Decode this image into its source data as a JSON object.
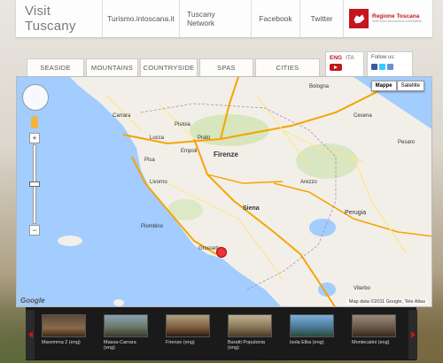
{
  "header": {
    "title": "Visit Tuscany",
    "links": [
      "Turismo.intoscana.it",
      "Tuscany Network",
      "Facebook",
      "Twitter"
    ],
    "region_name": "Regione Toscana",
    "region_subtitle": "diritti valori innovazione sostenibilità"
  },
  "nav": {
    "tabs": [
      "SEASIDE",
      "MOUNTAINS",
      "COUNTRYSIDE",
      "SPAS",
      "CITIES"
    ]
  },
  "lang": {
    "eng": "ENG",
    "ita": "ITA"
  },
  "follow": {
    "label": "Follow us:"
  },
  "map": {
    "type_buttons": [
      "Mappe",
      "Satellite"
    ],
    "active_type": "Mappe",
    "attribution": "Map data ©2011 Google, Tele Atlas",
    "logo": "Google",
    "places": [
      {
        "name": "Lucca"
      },
      {
        "name": "Pistoia"
      },
      {
        "name": "Prato"
      },
      {
        "name": "Firenze"
      },
      {
        "name": "Pisa"
      },
      {
        "name": "Livorno"
      },
      {
        "name": "Siena"
      },
      {
        "name": "Arezzo"
      },
      {
        "name": "Perugia"
      },
      {
        "name": "Grosseto"
      },
      {
        "name": "Viterbo"
      },
      {
        "name": "Carrara"
      },
      {
        "name": "Bologna"
      },
      {
        "name": "Cesena"
      },
      {
        "name": "Pesaro"
      },
      {
        "name": "Piombino"
      },
      {
        "name": "Empoli"
      }
    ]
  },
  "thumbnails": [
    {
      "caption": "Maremma 2 (eng)"
    },
    {
      "caption": "Massa-Carrara (eng)"
    },
    {
      "caption": "Firenze (eng)"
    },
    {
      "caption": "Baratti Populonia (eng)"
    },
    {
      "caption": "Isola Elba (eng)"
    },
    {
      "caption": "Montecatini (eng)"
    }
  ]
}
